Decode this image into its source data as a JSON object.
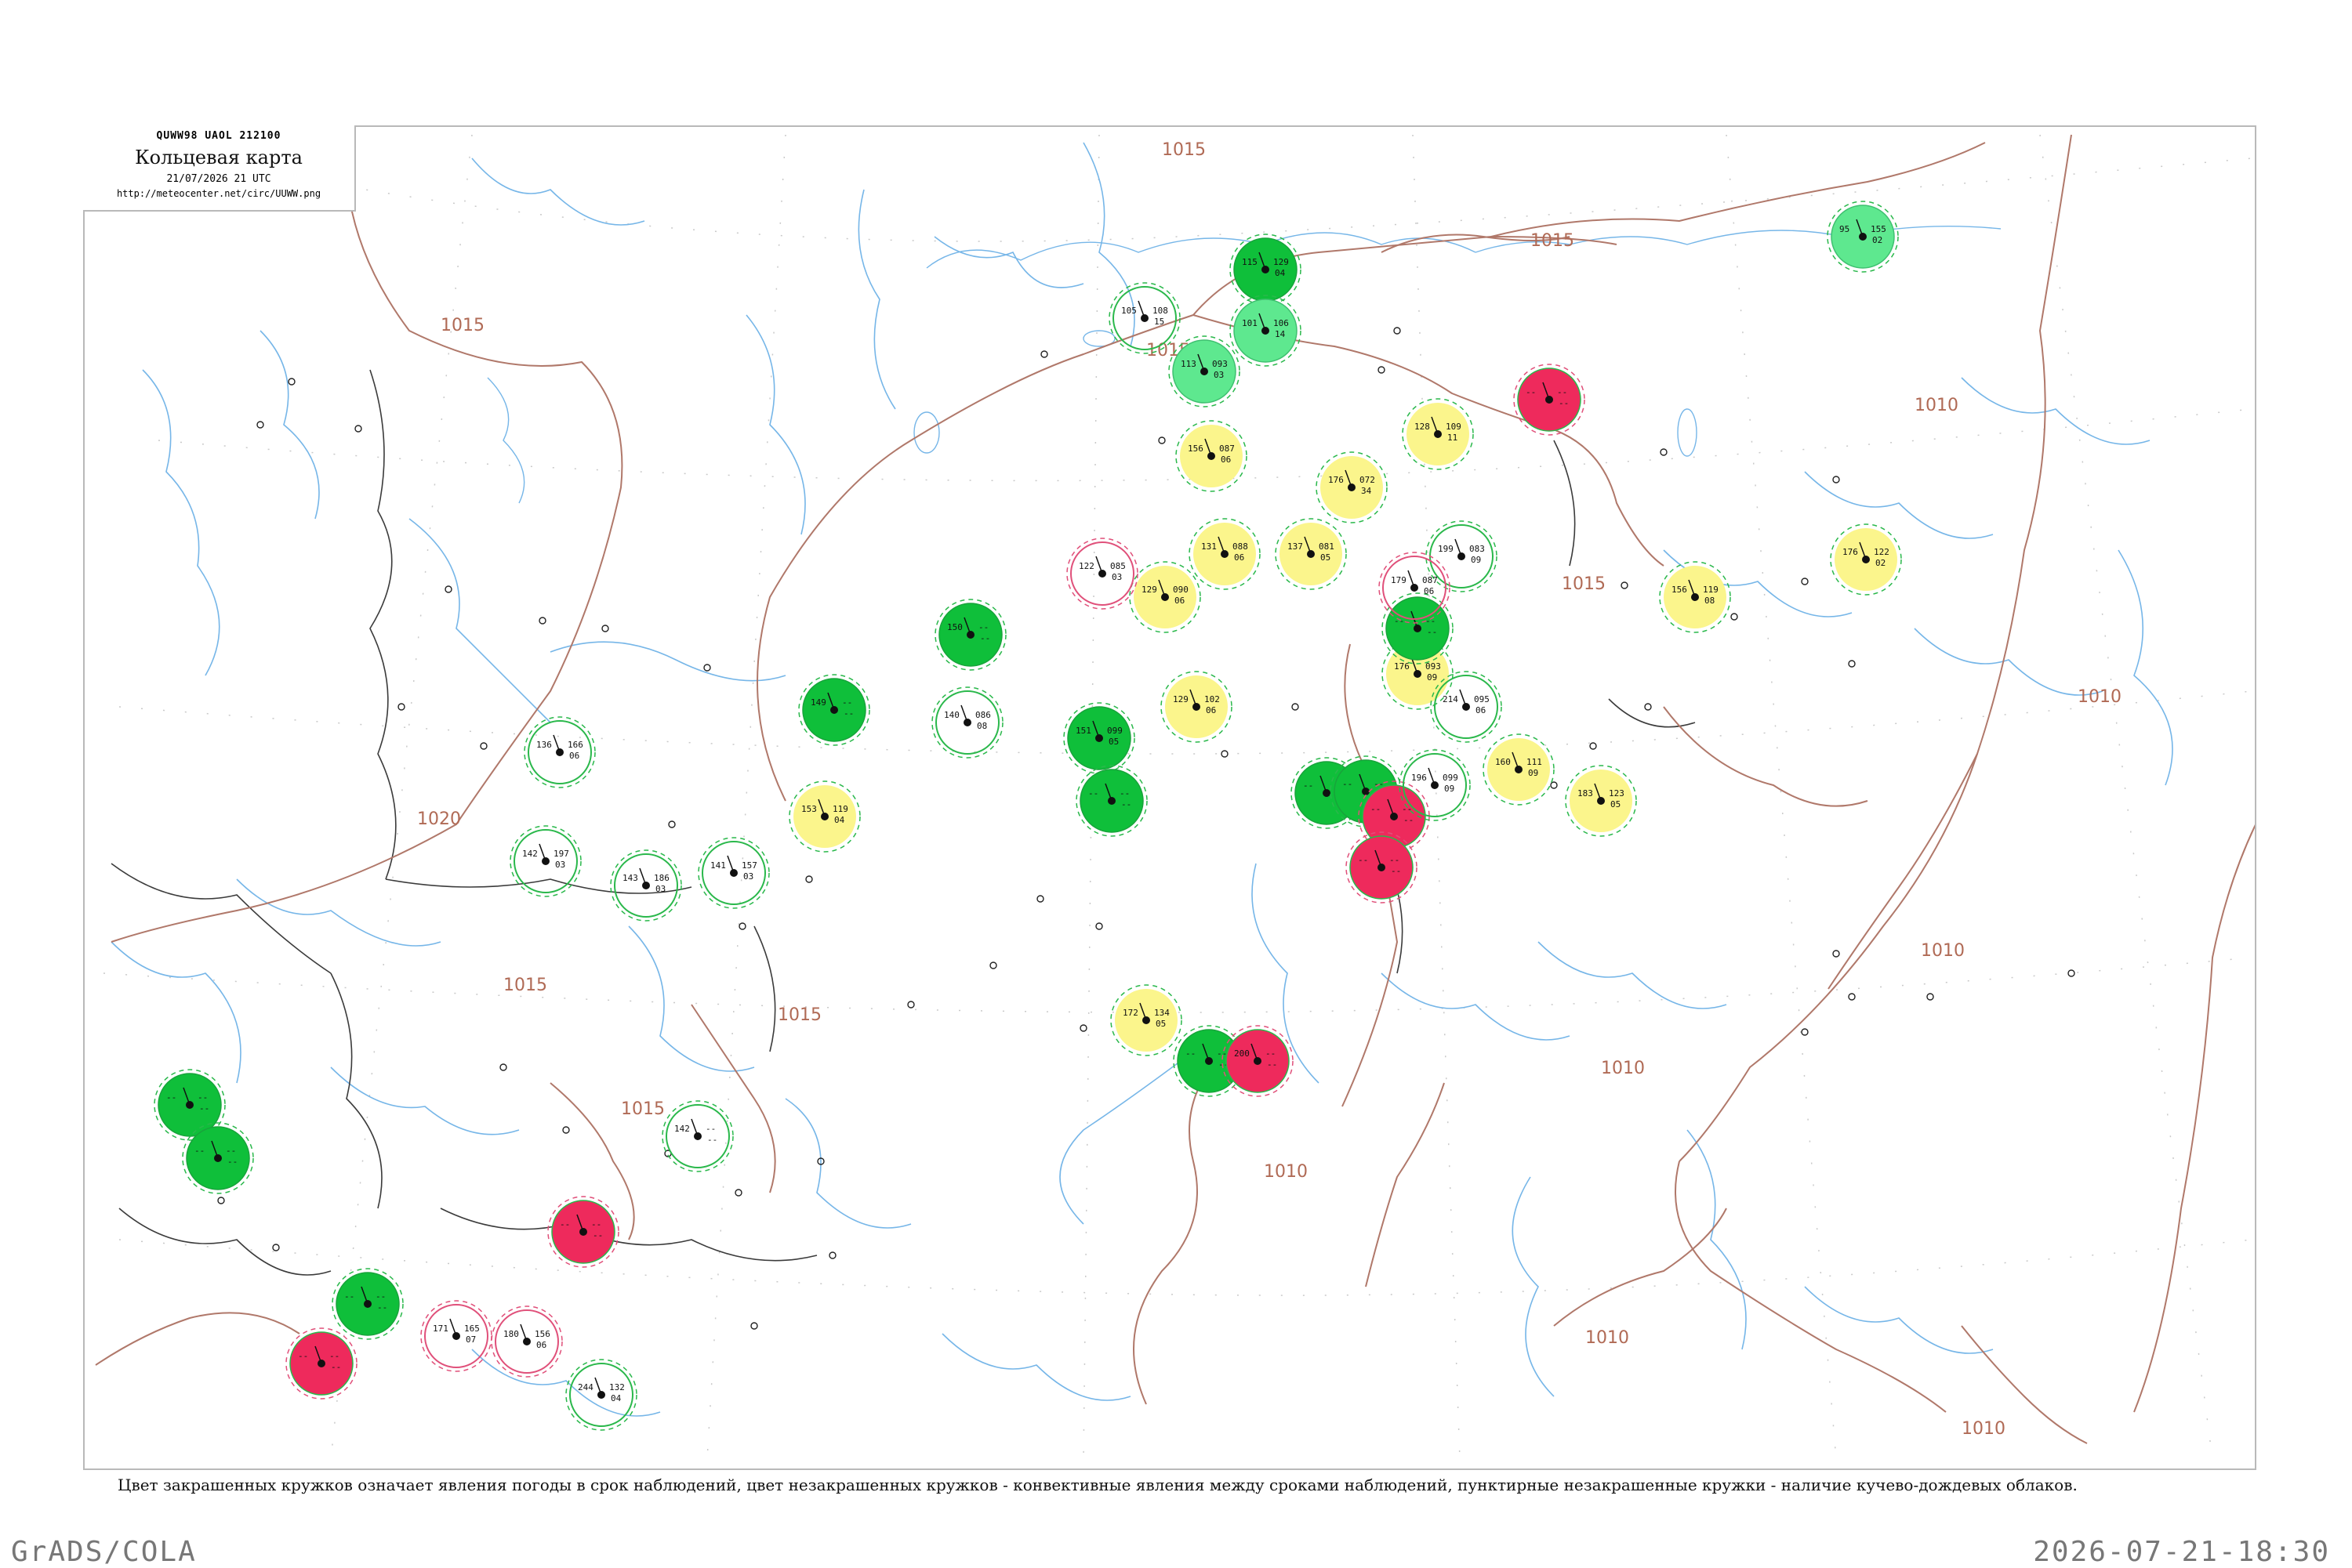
{
  "header": {
    "code": "QUWW98  UAOL  212100",
    "title": "Кольцевая карта",
    "date": "21/07/2026 21 UTC",
    "url": "http://meteocenter.net/circ/UUWW.png"
  },
  "caption": "Цвет закрашенных кружков означает явления погоды в срок наблюдений, цвет незакрашенных кружков - конвективные явления между сроками наблюдений, пунктирные незакрашенные кружки - наличие кучево-дождевых облаков.",
  "footer": {
    "left": "GrADS/COLA",
    "right": "2026-07-21-18:30"
  },
  "colors": {
    "fill_green": "#0fbf3a",
    "fill_light_green": "#5ee88f",
    "fill_yellow": "#fbf58c",
    "fill_red": "#ee2a5c",
    "ring_green": "#2ab84b",
    "ring_red": "#e0507a",
    "isobar": "#b0786a",
    "water": "#76b6e8",
    "border": "#3b3b3b"
  },
  "isobar_labels": [
    "1015",
    "1015",
    "1015",
    "1010",
    "1020",
    "1015",
    "1015",
    "1015",
    "1010",
    "1010",
    "1010",
    "1010",
    "1010",
    "1010",
    "1015",
    "1015"
  ],
  "stations": [
    {
      "t": "105",
      "td": "108",
      "p": "15",
      "kind": "ring-green"
    },
    {
      "t": "115",
      "td": "129",
      "p": "04",
      "kind": "fill-green"
    },
    {
      "t": "101",
      "td": "106",
      "p": "14",
      "kind": "fill-lgreen"
    },
    {
      "t": "113",
      "td": "093",
      "p": "03",
      "kind": "fill-lgreen"
    },
    {
      "t": "156",
      "td": "087",
      "p": "06",
      "kind": "fill-yellow"
    },
    {
      "t": "176",
      "td": "072",
      "p": "34",
      "kind": "fill-yellow"
    },
    {
      "t": "128",
      "td": "109",
      "p": "11",
      "kind": "fill-yellow"
    },
    {
      "t": "--",
      "td": "--",
      "p": "--",
      "kind": "fill-red"
    },
    {
      "t": "95",
      "td": "155",
      "p": "02",
      "kind": "fill-lgreen"
    },
    {
      "t": "176",
      "td": "122",
      "p": "02",
      "kind": "fill-yellow"
    },
    {
      "t": "131",
      "td": "088",
      "p": "06",
      "kind": "fill-yellow"
    },
    {
      "t": "137",
      "td": "081",
      "p": "05",
      "kind": "fill-yellow"
    },
    {
      "t": "129",
      "td": "090",
      "p": "06",
      "kind": "fill-yellow"
    },
    {
      "t": "122",
      "td": "085",
      "p": "03",
      "kind": "ring-red"
    },
    {
      "t": "150",
      "td": "--",
      "p": "--",
      "kind": "fill-green"
    },
    {
      "t": "176",
      "td": "093",
      "p": "09",
      "kind": "fill-yellow"
    },
    {
      "t": "--",
      "td": "--",
      "p": "--",
      "kind": "fill-green"
    },
    {
      "t": "129",
      "td": "102",
      "p": "06",
      "kind": "fill-yellow"
    },
    {
      "t": "151",
      "td": "099",
      "p": "05",
      "kind": "fill-green"
    },
    {
      "t": "--",
      "td": "--",
      "p": "--",
      "kind": "fill-green"
    },
    {
      "t": "149",
      "td": "--",
      "p": "--",
      "kind": "fill-green"
    },
    {
      "t": "140",
      "td": "086",
      "p": "08",
      "kind": "ring-green"
    },
    {
      "t": "153",
      "td": "119",
      "p": "04",
      "kind": "fill-yellow"
    },
    {
      "t": "--",
      "td": "--",
      "p": "--",
      "kind": "fill-green"
    },
    {
      "t": "--",
      "td": "--",
      "p": "--",
      "kind": "fill-green"
    },
    {
      "t": "--",
      "td": "--",
      "p": "--",
      "kind": "fill-red"
    },
    {
      "t": "--",
      "td": "--",
      "p": "--",
      "kind": "fill-red"
    },
    {
      "t": "160",
      "td": "111",
      "p": "09",
      "kind": "fill-yellow"
    },
    {
      "t": "183",
      "td": "123",
      "p": "05",
      "kind": "fill-yellow"
    },
    {
      "t": "156",
      "td": "119",
      "p": "08",
      "kind": "fill-yellow"
    },
    {
      "t": "172",
      "td": "134",
      "p": "05",
      "kind": "fill-yellow"
    },
    {
      "t": "--",
      "td": "--",
      "p": "--",
      "kind": "fill-green"
    },
    {
      "t": "200",
      "td": "--",
      "p": "--",
      "kind": "fill-red"
    },
    {
      "t": "--",
      "td": "--",
      "p": "--",
      "kind": "fill-green"
    },
    {
      "t": "--",
      "td": "--",
      "p": "--",
      "kind": "fill-green"
    },
    {
      "t": "--",
      "td": "--",
      "p": "--",
      "kind": "fill-red"
    },
    {
      "t": "--",
      "td": "--",
      "p": "--",
      "kind": "fill-green"
    },
    {
      "t": "--",
      "td": "--",
      "p": "--",
      "kind": "fill-red"
    },
    {
      "t": "142",
      "td": "197",
      "p": "03",
      "kind": "ring-green"
    },
    {
      "t": "136",
      "td": "166",
      "p": "06",
      "kind": "ring-green"
    },
    {
      "t": "143",
      "td": "186",
      "p": "03",
      "kind": "ring-green"
    },
    {
      "t": "141",
      "td": "157",
      "p": "03",
      "kind": "ring-green"
    },
    {
      "t": "142",
      "td": "--",
      "p": "--",
      "kind": "ring-green"
    },
    {
      "t": "244",
      "td": "132",
      "p": "04",
      "kind": "ring-green"
    },
    {
      "t": "171",
      "td": "165",
      "p": "07",
      "kind": "ring-red"
    },
    {
      "t": "180",
      "td": "156",
      "p": "06",
      "kind": "ring-red"
    },
    {
      "t": "199",
      "td": "083",
      "p": "09",
      "kind": "ring-green"
    },
    {
      "t": "179",
      "td": "087",
      "p": "06",
      "kind": "ring-red"
    },
    {
      "t": "196",
      "td": "099",
      "p": "09",
      "kind": "ring-green"
    },
    {
      "t": "214",
      "td": "095",
      "p": "06",
      "kind": "ring-green"
    }
  ]
}
